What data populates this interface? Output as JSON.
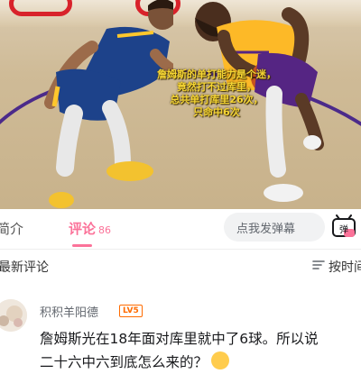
{
  "video": {
    "danmaku_lines": [
      "詹姆斯的单打能力是个迷，",
      "竟然打不过库里，",
      "总共单打库里26次，",
      "只命中6次"
    ]
  },
  "tabs": {
    "intro_label": "简介",
    "comments_label": "评论",
    "comments_count": "86",
    "active_color": "#fb7299"
  },
  "danmaku_input": {
    "placeholder": "点我发弹幕",
    "toggle_icon_label": "弹"
  },
  "sort": {
    "title": "最新评论",
    "mode_label": "按时间"
  },
  "comment": {
    "username": "积积羊阳德",
    "level": "LV5",
    "text_line1": "詹姆斯光在18年面对库里就中了6球。所以说",
    "text_line2": "二十六中六到底怎么来的？",
    "emoji": "thinking-face"
  }
}
